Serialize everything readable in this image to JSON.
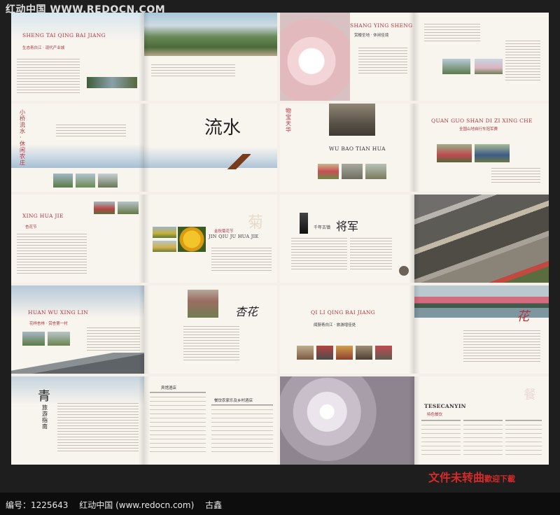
{
  "header": {
    "watermark": "红动中国 WWW.REDOCN.COM"
  },
  "spreads": {
    "s1": {
      "title": "SHENG TAI QING BAI JIANG",
      "title_cn": "生态青白江 · 现代产业城"
    },
    "s2": {
      "title": "SHANG YING SHENG DI",
      "title_cn": "赏樱圣地 · 休闲佳境"
    },
    "s3": {
      "vertical_cn": "小桥流水 · 休闲农庄",
      "calligraphy": "流水"
    },
    "s4": {
      "vertical_cn": "物宝天华",
      "title": "WU BAO TIAN HUA",
      "title2": "QUAN GUO SHAN DI ZI XING CHE",
      "title2_cn": "全国山地自行车冠军赛"
    },
    "s5": {
      "title": "XING HUA JIE",
      "title_cn": "杏花节",
      "accent_char": "菊",
      "title2": "JIN QIU JU HUA JIE",
      "title2_cn": "金秋菊花节"
    },
    "s6": {
      "title_cn": "千年古镇",
      "calligraphy": "将军"
    },
    "s7": {
      "title": "HUAN WU XING LIN",
      "title_cn": "花样杏林 · 赏杏第一村",
      "calligraphy": "杏花"
    },
    "s8": {
      "title": "QI LI QING BAI JIANG",
      "title_cn": "闻厨青白江 · 旅游增佳处",
      "calligraphy": "花"
    },
    "s9": {
      "calligraphy": "青",
      "vertical_cn": "旅游指南",
      "title_cn": "宾馆酒店",
      "title2_cn": "餐饮农家乐及乡村酒店"
    },
    "s10": {
      "accent_char": "餐",
      "title": "TESECANYIN",
      "title_cn": "特色餐饮"
    }
  },
  "footer": {
    "slogan_main": "文件未转曲",
    "slogan_small": "歡迎下載",
    "id_label": "编号：1225643",
    "site": "红动中国 (www.redocn.com)",
    "author": "古鑫"
  },
  "colors": {
    "accent_red": "#b5333c",
    "background": "#1e1e1e"
  }
}
